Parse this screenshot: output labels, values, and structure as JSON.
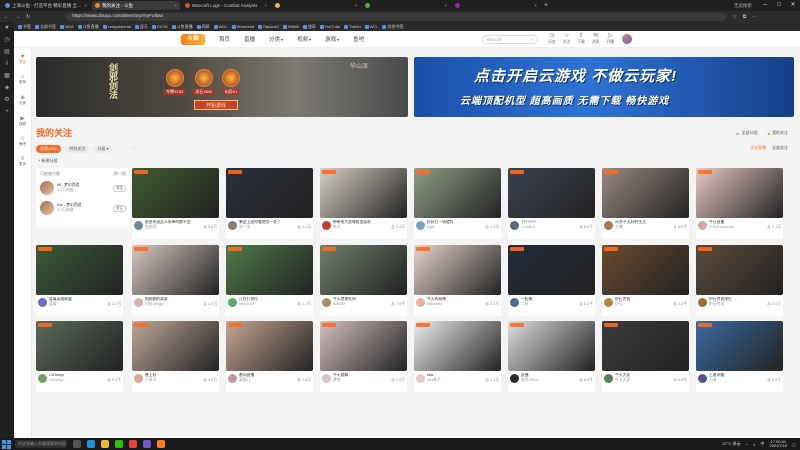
{
  "browser": {
    "tabs": [
      {
        "label": "上海斗鱼 - 打造平台 精彩直播 全民嗨",
        "color": "#5b8ee6",
        "active": false
      },
      {
        "label": "我的关注 - 斗鱼",
        "color": "#ff7e1b",
        "active": true
      },
      {
        "label": "Warcraft Logs - Combat Analysis",
        "color": "#d94f2a",
        "active": false
      },
      {
        "label": "",
        "color": "#e0b93a",
        "active": false
      },
      {
        "label": "",
        "color": "#4caf50",
        "active": false
      },
      {
        "label": "",
        "color": "#9c27b0",
        "active": false
      }
    ],
    "tab_right_label": "无此搜索",
    "url": "https://www.douyu.com/directory/myFollow",
    "bookmarks": [
      "书签",
      "全部书签",
      "NGA",
      "斗鱼直播",
      "Leaguepedia",
      "虎牙",
      "DOTA",
      "斗鱼直播",
      "网易",
      "WCL",
      "Wowhead",
      "RaiderIO",
      "Bilibili",
      "战网",
      "YouTube",
      "Twitch",
      "WCL",
      "其他书签"
    ]
  },
  "site": {
    "logo_text": "斗鱼",
    "nav": [
      {
        "label": "首页"
      },
      {
        "label": "直播"
      },
      {
        "label": "分类",
        "arrow": "▾"
      },
      {
        "label": "视频",
        "arrow": "▾"
      },
      {
        "label": "游戏",
        "arrow": "▾"
      },
      {
        "label": "鱼吧"
      }
    ],
    "search_placeholder": "lifecraft",
    "header_icons": [
      {
        "icon": "clock-icon",
        "glyph": "◷",
        "label": "历史"
      },
      {
        "icon": "star-icon",
        "glyph": "☆",
        "label": "关注"
      },
      {
        "icon": "upload-icon",
        "glyph": "⇪",
        "label": "下载"
      },
      {
        "icon": "message-icon",
        "glyph": "✉",
        "label": "消息"
      },
      {
        "icon": "live-icon",
        "glyph": "▷",
        "label": "开播"
      }
    ]
  },
  "left_rail": [
    {
      "icon": "follow-icon",
      "glyph": "♥",
      "label": "关注",
      "active": true
    },
    {
      "icon": "home-icon",
      "glyph": "⌂",
      "label": "推荐"
    },
    {
      "icon": "game-icon",
      "glyph": "◈",
      "label": "分类"
    },
    {
      "icon": "video-icon",
      "glyph": "▶",
      "label": "视频"
    },
    {
      "icon": "group-icon",
      "glyph": "☺",
      "label": "鱼吧"
    },
    {
      "icon": "more-icon",
      "glyph": "≡",
      "label": "更多"
    }
  ],
  "banners": {
    "left": {
      "title": "剑邪剑法",
      "items": [
        "令牌X100",
        "灵石X5W",
        "化药X1"
      ],
      "button": "开始游戏",
      "tag": "华山派"
    },
    "right": {
      "line1": "点击开启云游戏 不做云玩家!",
      "line2": "云端顶配机型 超高画质 无需下载 畅快游戏"
    }
  },
  "follow": {
    "title": "我的关注",
    "right_links": [
      "全部分组",
      "我的关注"
    ],
    "filters": [
      {
        "label": "全部(108)",
        "active": true
      },
      {
        "label": "特别关注",
        "active": false
      },
      {
        "label": "分组 ▾",
        "active": false
      }
    ],
    "filters_right": [
      "正在直播",
      "全部关注"
    ],
    "add_group": "+ 新建分组"
  },
  "recommend": {
    "header": "可能感兴趣",
    "header_right": "换一换",
    "items": [
      {
        "name": "lift - 梦幻西游",
        "sub": "4.2万热度",
        "button": "关注"
      },
      {
        "name": "Kar - 梦幻西游",
        "sub": "2.1万热度",
        "button": "关注"
      }
    ]
  },
  "cards": [
    {
      "title": "赵启明说这么简单的都不会",
      "streamer": "赵启明",
      "hot": "5.8万",
      "avatar": "#6b8e9b",
      "thumb": "#3e5a2e"
    },
    {
      "title": "聚这上面你看他笑一笑了",
      "streamer": "笑一笑",
      "hot": "2.1万",
      "avatar": "#8c7a6a",
      "thumb": "#2a2e3c"
    },
    {
      "title": "带带老大是哪组里面呢",
      "streamer": "老大",
      "hot": "3.4万",
      "avatar": "#c0402b",
      "thumb": "#d9d0c4"
    },
    {
      "title": "好好打一场就好",
      "streamer": "pigff",
      "hot": "1.2万",
      "avatar": "#7aa2c6",
      "thumb": "#8f9e86"
    },
    {
      "title": "???????",
      "streamer": "1/Videor",
      "hot": "8.8千",
      "avatar": "#5a6b7d",
      "thumb": "#394150"
    },
    {
      "title": "20岁不太好的生活",
      "streamer": "主播",
      "hot": "6.5千",
      "avatar": "#b07650",
      "thumb": "#9a8a80"
    },
    {
      "title": "今日直播",
      "streamer": "ZHDKVanessa",
      "hot": "4.1万",
      "avatar": "#d6a6a0",
      "thumb": "#e9c9c4"
    },
    {
      "title": "蓝莓英雄联盟",
      "streamer": "蓝莓",
      "hot": "2.2万",
      "avatar": "#6c6cbf",
      "thumb": "#3a5a3a"
    },
    {
      "title": "照顾她的弟弟",
      "streamer": "阿拉dengyi",
      "hot": "1.9万",
      "avatar": "#e0b0b0",
      "thumb": "#d8c8c0"
    },
    {
      "title": "正在打排位",
      "streamer": "ImpOUO",
      "hot": "1.1万",
      "avatar": "#5ea86a",
      "thumb": "#4e7a4a"
    },
    {
      "title": "今天就来吃鸡",
      "streamer": "AIM4M",
      "hot": "7.6千",
      "avatar": "#a88c5c",
      "thumb": "#6f7f6a"
    },
    {
      "title": "今天的直播",
      "streamer": "Mikanalll",
      "hot": "3.3万",
      "avatar": "#e8b0a0",
      "thumb": "#e8d4cc"
    },
    {
      "title": "一起来",
      "streamer": "二叶",
      "hot": "5.2千",
      "avatar": "#4a6a9a",
      "thumb": "#222a3a"
    },
    {
      "title": "炉石传说",
      "streamer": "炉石",
      "hot": "4.8千",
      "avatar": "#b08840",
      "thumb": "#6a4a30"
    },
    {
      "title": "炉石传说排位",
      "streamer": "炉石传说",
      "hot": "2.0万",
      "avatar": "#9a6a3a",
      "thumb": "#5c4a3a"
    },
    {
      "title": "LVDedyv",
      "streamer": "LVDedyv",
      "hot": "9.1千",
      "avatar": "#7a9a6a",
      "thumb": "#596a5a"
    },
    {
      "title": "晚上好",
      "streamer": "小胖子",
      "hot": "3.6万",
      "avatar": "#d8a890",
      "thumb": "#bfa89a"
    },
    {
      "title": "晚间直播",
      "streamer": "梁雨儿",
      "hot": "2.6万",
      "avatar": "#c898a0",
      "thumb": "#c6a694"
    },
    {
      "title": "今天跳舞",
      "streamer": "梦想",
      "hot": "1.5万",
      "avatar": "#e0c0c8",
      "thumb": "#d6c0c0"
    },
    {
      "title": "Mia",
      "streamer": "Mia酱子",
      "hot": "1.3万",
      "avatar": "#e8c8c0",
      "thumb": "#eeeeee"
    },
    {
      "title": "直播",
      "streamer": "老色Olivia",
      "hot": "8.4千",
      "avatar": "#2a2a2a",
      "thumb": "#dedede"
    },
    {
      "title": "今天大家",
      "streamer": "今天大家",
      "hot": "6.0千",
      "avatar": "#5a7a5a",
      "thumb": "#3a3a3a"
    },
    {
      "title": "王者荣耀",
      "streamer": "王者",
      "hot": "5.5千",
      "avatar": "#4a5a8a",
      "thumb": "#3a6aa0"
    },
    {
      "title": "今晚",
      "streamer": "主播",
      "hot": "2.8千",
      "avatar": "#6a6a6a",
      "thumb": "#7a8a7a"
    }
  ],
  "taskbar": {
    "search": "在这里输入你要搜索的内容",
    "time": "17:00:41",
    "date": "2021/7/19",
    "weather": "27°C 多云",
    "lang": "中"
  }
}
